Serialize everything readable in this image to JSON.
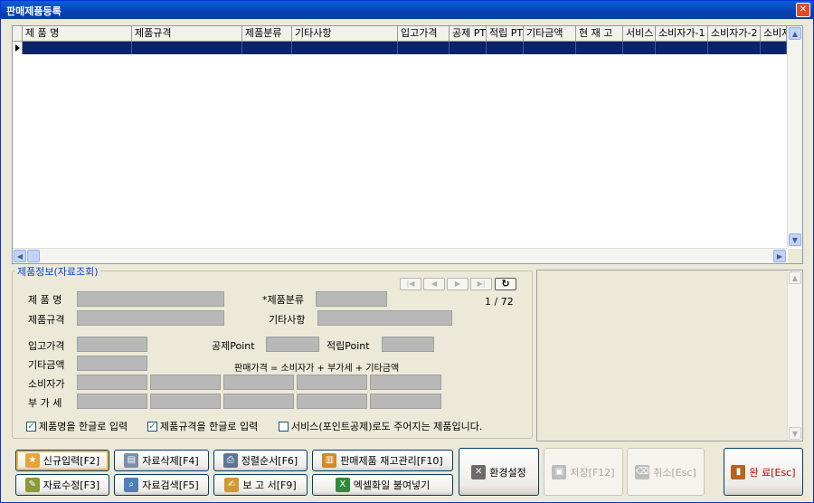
{
  "window": {
    "title": "판매제품등록",
    "close": "✕"
  },
  "grid": {
    "columns": [
      "제 품 명",
      "제품규격",
      "제품분류",
      "기타사항",
      "입고가격",
      "공제 PT",
      "적립 PT",
      "기타금액",
      "현 재 고",
      "서비스",
      "소비자가-1",
      "소비자가-2",
      "소비자"
    ]
  },
  "group": {
    "title": "제품정보(자료조회)",
    "labels": {
      "name": "제 품 명",
      "spec": "제품규격",
      "category": "*제품분류",
      "etc": "기타사항",
      "in_price": "입고가격",
      "deduct_point": "공제Point",
      "save_point": "적립Point",
      "etc_amount": "기타금액",
      "formula": "판매가격 = 소비자가 + 부가세 + 기타금액",
      "consumer_price": "소비자가",
      "vat": "부 가 세"
    },
    "record_counter": "1 / 72",
    "nav": {
      "first": "|◀",
      "prev": "◀",
      "next": "▶",
      "last": "▶|",
      "refresh": "↻"
    },
    "checks": [
      {
        "label": "제품명을 한글로 입력",
        "checked": true
      },
      {
        "label": "제품규격을 한글로 입력",
        "checked": true
      },
      {
        "label": "서비스(포인트공제)로도 주어지는 제품입니다.",
        "checked": false
      }
    ]
  },
  "buttons": {
    "new": "신규입력[F2]",
    "delete": "자료삭제[F4]",
    "sort": "정렬순서[F6]",
    "stock": "판매제품 재고관리[F10]",
    "settings": "환경설정",
    "save": "저장[F12]",
    "cancel": "취소[Esc]",
    "done": "완 료[Esc]",
    "edit": "자료수정[F3]",
    "search": "자료검색[F5]",
    "report": "보 고 서[F9]",
    "excel": "엑셀화일 불여넣기"
  },
  "colors": {
    "title_bar": "#0A5FD8",
    "selection": "#0A246A",
    "field": "#B8B8B8",
    "group_title": "#0046D5",
    "done_text": "#C00000"
  }
}
